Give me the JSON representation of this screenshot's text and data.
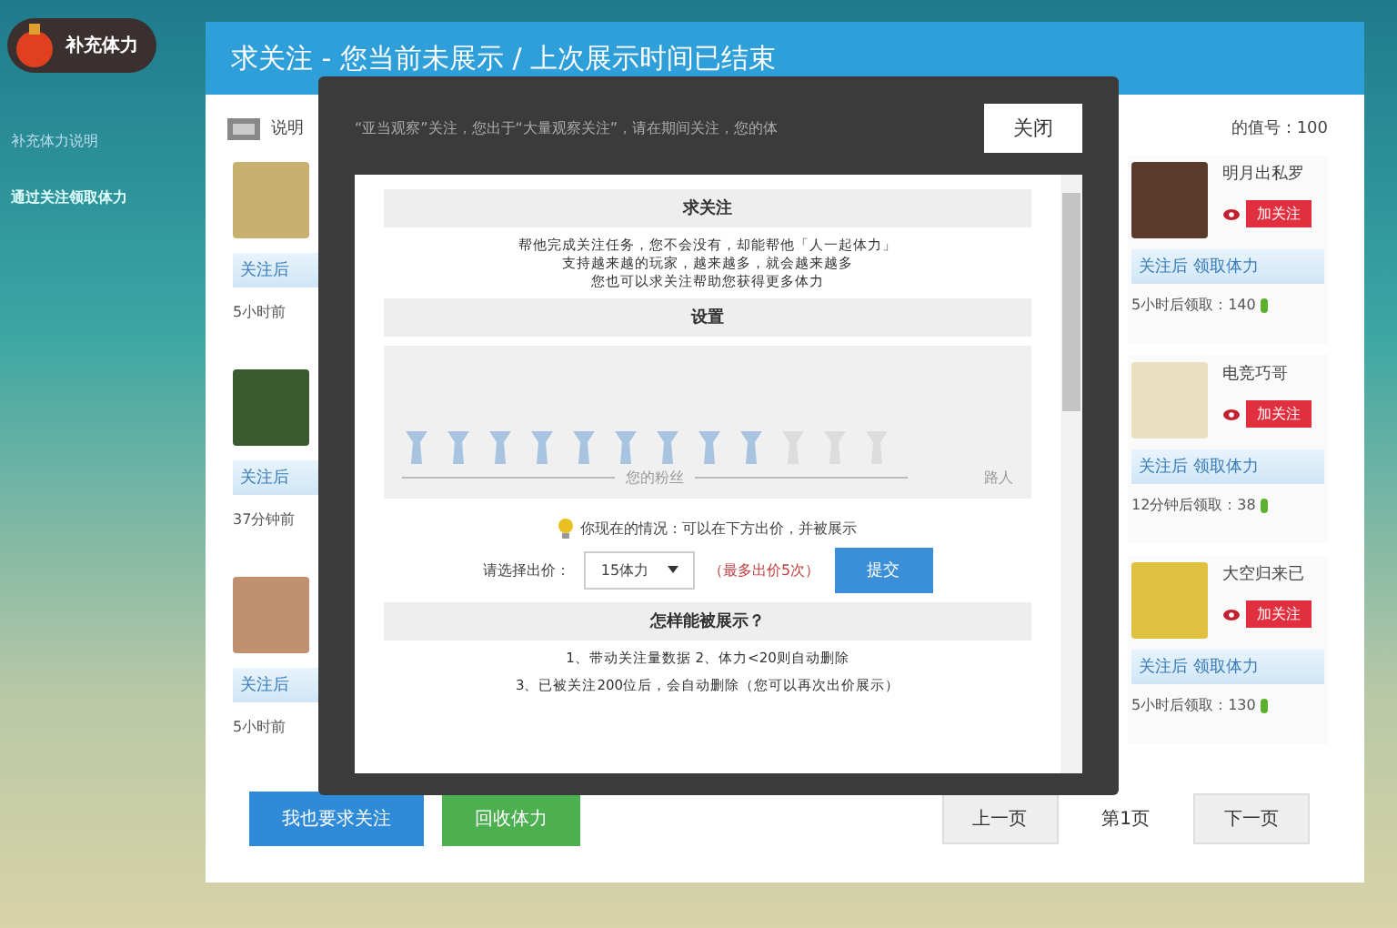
{
  "logo": {
    "title": "补充体力"
  },
  "sidebar": {
    "items": [
      {
        "label": "补充体力说明",
        "selected": false
      },
      {
        "label": "通过关注领取体力",
        "selected": true
      }
    ]
  },
  "panel": {
    "title": "求关注 - 您当前未展示 / 上次展示时间已结束",
    "info_label": "说明",
    "info_value": "的值号：100"
  },
  "left_cards": [
    {
      "pill": "关注后",
      "time": "5小时前"
    },
    {
      "pill": "关注后",
      "time": "37分钟前"
    },
    {
      "pill": "关注后",
      "time": "5小时前"
    }
  ],
  "right_cards": [
    {
      "name": "明月出私罗",
      "follow": "加关注",
      "pill": "关注后 领取体力",
      "time": "5小时后领取：140"
    },
    {
      "name": "电竞巧哥",
      "follow": "加关注",
      "pill": "关注后 领取体力",
      "time": "12分钟后领取：38"
    },
    {
      "name": "大空归来已",
      "follow": "加关注",
      "pill": "关注后 领取体力",
      "time": "5小时后领取：130"
    }
  ],
  "footer": {
    "primary": "我也要求关注",
    "secondary": "回收体力",
    "prev": "上一页",
    "page": "第1页",
    "next": "下一页"
  },
  "dialog": {
    "close": "关闭",
    "strip_text": "“亚当观察”关注，您出于“大量观察关注”，请在期间关注，您的体",
    "section_title": "求关注",
    "paragraph": [
      "帮他完成关注任务，您不会没有，却能帮他「人一起体力」",
      "支持越来越的玩家，越来越多，就会越来越多",
      "您也可以求关注帮助您获得更多体力"
    ],
    "settings_title": "设置",
    "figures": [
      {
        "active": true
      },
      {
        "active": true
      },
      {
        "active": true
      },
      {
        "active": true
      },
      {
        "active": true
      },
      {
        "active": true
      },
      {
        "active": true
      },
      {
        "active": true
      },
      {
        "active": true
      },
      {
        "active": false
      },
      {
        "active": false
      },
      {
        "active": false
      }
    ],
    "fans_label": "您的粉丝",
    "passer_label": "路人",
    "tip": "你现在的情况：可以在下方出价，并被展示",
    "bid_label": "请选择出价：",
    "bid_value": "15体力",
    "bid_note": "（最多出价5次）",
    "submit": "提交",
    "how_title": "怎样能被展示？",
    "how_lines": [
      "1、带动关注量数据 2、体力<20则自动删除",
      "3、已被关注200位后，会自动删除（您可以再次出价展示）"
    ]
  }
}
